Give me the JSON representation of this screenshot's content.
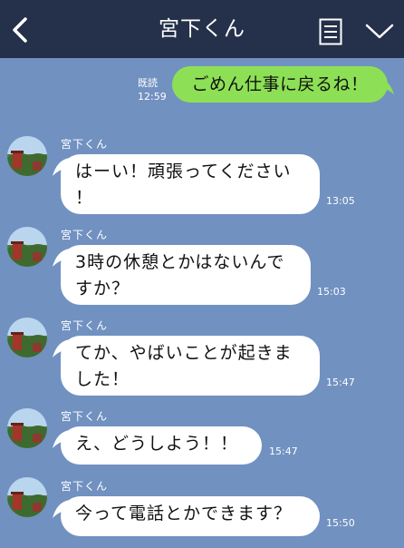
{
  "header": {
    "title": "宮下くん"
  },
  "sent": {
    "read_label": "既読",
    "time": "12:59",
    "text": "ごめん仕事に戻るね！"
  },
  "messages": [
    {
      "sender": "宮下くん",
      "lines": [
        "はーい！頑張ってください",
        "！"
      ],
      "time": "13:05"
    },
    {
      "sender": "宮下くん",
      "lines": [
        "3時の休憩とかはないんで",
        "すか？"
      ],
      "time": "15:03"
    },
    {
      "sender": "宮下くん",
      "lines": [
        "てか、やばいことが起きま",
        "した！"
      ],
      "time": "15:47"
    },
    {
      "sender": "宮下くん",
      "lines": [
        "え、どうしよう！！"
      ],
      "time": "15:47"
    },
    {
      "sender": "宮下くん",
      "lines": [
        "今って電話とかできます？"
      ],
      "time": "15:50"
    }
  ],
  "colors": {
    "background": "#7191c1",
    "header": "#25304a",
    "sent_bubble": "#8de055",
    "received_bubble": "#ffffff"
  },
  "icons": {
    "back": "back-chevron-icon",
    "notes": "notes-icon",
    "menu": "chevron-down-icon",
    "avatar": "avatar-image"
  }
}
